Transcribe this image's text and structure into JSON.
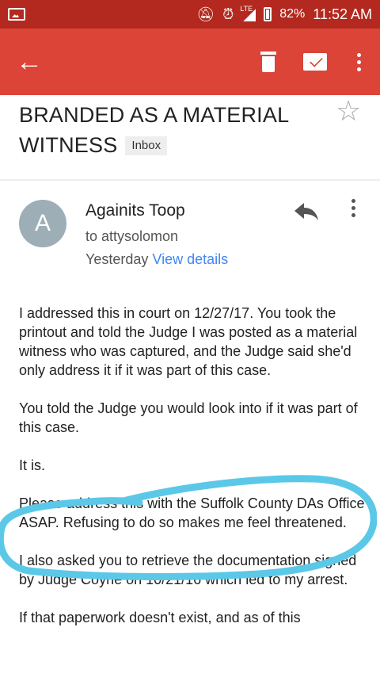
{
  "status_bar": {
    "network": "LTE",
    "battery": "82%",
    "time": "11:52 AM"
  },
  "app_bar": {
    "icons": [
      "back-arrow-icon",
      "trash-icon",
      "mail-icon",
      "overflow-menu-icon"
    ]
  },
  "email": {
    "subject": "BRANDED AS A MATERIAL WITNESS",
    "label": "Inbox",
    "sender_initial": "A",
    "sender": "Againits Toop",
    "recipient": "to attysolomon",
    "date": "Yesterday",
    "view_details": "View details",
    "paragraphs": [
      "I addressed this in court on 12/27/17. You took the printout and told the Judge I was posted as a material witness who was captured, and the Judge said she'd only address it if it was part of this case.",
      "You told the Judge you would look into if it was part of this case.",
      "It is.",
      "Please address this with the Suffolk County DAs Office ASAP. Refusing to do so makes me feel threatened.",
      "I also asked you to retrieve the documentation signed by Judge Coyne on 10/21/16 which led to my arrest.",
      "If that paperwork doesn't exist, and as of this"
    ]
  },
  "colors": {
    "status_bar": "#b3291f",
    "app_bar": "#db4437",
    "link": "#4285f4",
    "highlight_marker": "#5bc8e8"
  }
}
